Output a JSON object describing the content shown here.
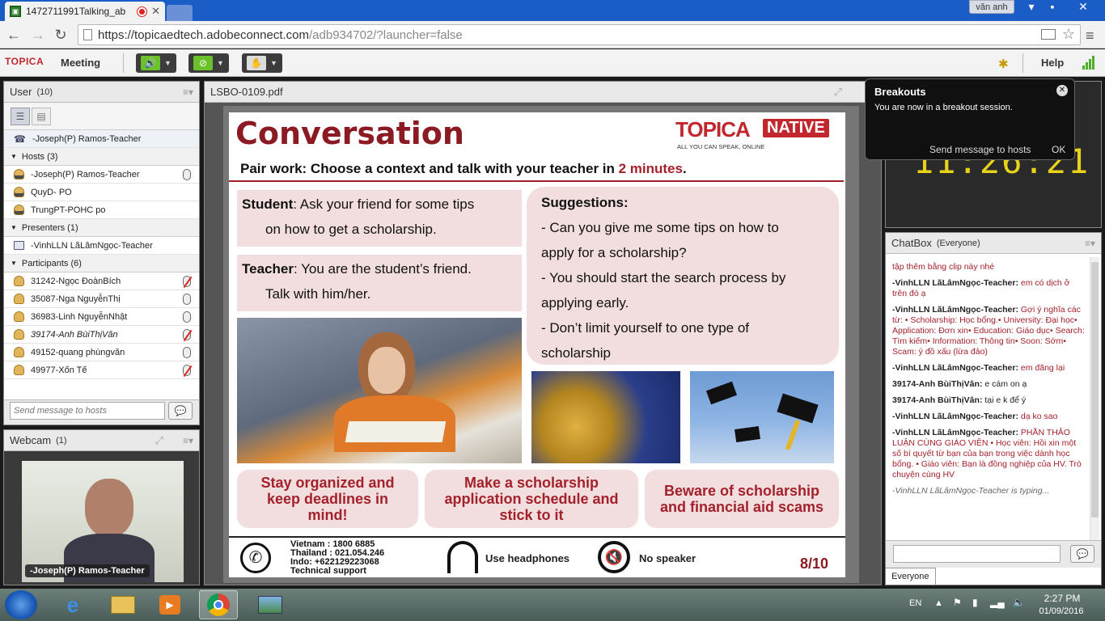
{
  "browser": {
    "tab_title": "1472711991Talking_ab",
    "user_name": "văn anh",
    "url_host": "https://topicaedtech.adobeconnect.com",
    "url_path": "/adb934702/?launcher=false"
  },
  "menubar": {
    "logo": "TOPICA",
    "meeting_label": "Meeting",
    "help_label": "Help"
  },
  "user_pod": {
    "title": "User",
    "count": "(10)",
    "current_user": "-Joseph(P) Ramos-Teacher",
    "hosts_label": "Hosts (3)",
    "hosts": [
      "-Joseph(P) Ramos-Teacher",
      "QuyD- PO",
      "TrungPT-POHC po"
    ],
    "presenters_label": "Presenters (1)",
    "presenters": [
      "-VinhLLN LãLâmNgọc-Teacher"
    ],
    "participants_label": "Participants (6)",
    "participants": [
      {
        "name": "31242-Ngọc ĐoànBích",
        "mic": "off",
        "italic": false
      },
      {
        "name": "35087-Nga NguyễnThị",
        "mic": "on",
        "italic": false
      },
      {
        "name": "36983-Linh NguyễnNhật",
        "mic": "on",
        "italic": false
      },
      {
        "name": "39174-Anh BùiThịVân",
        "mic": "off",
        "italic": true
      },
      {
        "name": "49152-quang phùngvăn",
        "mic": "on",
        "italic": false
      },
      {
        "name": "49977-Xốn Tế",
        "mic": "off",
        "italic": false
      }
    ],
    "send_placeholder": "Send message to hosts"
  },
  "webcam_pod": {
    "title": "Webcam",
    "count": "(1)",
    "caption": "-Joseph(P) Ramos-Teacher"
  },
  "share_pod": {
    "title": "LSBO-0109.pdf"
  },
  "slide": {
    "heading": "Conversation",
    "brand_main": "TOPICA",
    "brand_tag": "NATIVE",
    "brand_sub": "ALL YOU CAN SPEAK, ONLINE",
    "instruction_pre": "Pair work: Choose a context and talk with your teacher in ",
    "instruction_hl": "2 minutes",
    "instruction_post": ".",
    "student_label": "Student",
    "student_line1": ": Ask your friend for some tips",
    "student_line2": "on how to get a scholarship.",
    "teacher_label": "Teacher",
    "teacher_line1": ": You are the student’s friend.",
    "teacher_line2": "Talk with him/her.",
    "suggestions_title": "Suggestions:",
    "suggestions": [
      "- Can you give me some tips on how to",
      "apply for a scholarship?",
      "- You should start the search process by",
      "applying early.",
      "-  Don’t limit yourself to one type of",
      "scholarship"
    ],
    "tips": [
      "Stay organized and keep deadlines in mind!",
      "Make a scholarship application schedule and stick to it",
      "Beware of scholarship and financial aid scams"
    ],
    "support_lines": [
      "Vietnam :  1800 6885",
      "Thailand :  021.054.246",
      "Indo:   +622129223068",
      "Technical support"
    ],
    "headphones_label": "Use headphones",
    "speaker_label": "No speaker",
    "page": "8/10"
  },
  "breakouts": {
    "title": "Breakouts",
    "message": "You are now in a breakout session.",
    "send_label": "Send message to hosts",
    "ok_label": "OK",
    "timer": "11:26:21"
  },
  "chat_pod": {
    "title": "ChatBox",
    "scope": "(Everyone)",
    "messages": [
      {
        "who": "",
        "text": "tập thêm bằng clip này nhé",
        "red": true
      },
      {
        "who": "-VinhLLN LãLâmNgọc-Teacher:",
        "text": "em có dịch ở trên đó ạ",
        "red": true
      },
      {
        "who": "-VinhLLN LãLâmNgọc-Teacher:",
        "text": "Gợi ý nghĩa các từ:        •       Scholarship: Học bổng.•     University: Đại học•        Application: Đơn xin•       Education: Giáo dục•        Search: Tìm kiếm•         Information: Thông tin•       Soon: Sớm•        Scam: ý đồ xấu (lừa đảo)",
        "red": true
      },
      {
        "who": "-VinhLLN LãLâmNgọc-Teacher:",
        "text": "em đăng lại",
        "red": true
      },
      {
        "who": "39174-Anh BùiThịVân:",
        "text": "e cám on ạ",
        "red": false
      },
      {
        "who": "39174-Anh BùiThịVân:",
        "text": "tại e k để ý",
        "red": false
      },
      {
        "who": "-VinhLLN LãLâmNgọc-Teacher:",
        "text": "dạ ko sao",
        "red": true
      },
      {
        "who": "-VinhLLN LãLâmNgọc-Teacher:",
        "text": "PHẦN THẢO LUẬN CÙNG GIÁO VIÊN        •      Học viên: Hồi xin một số bí quyết từ bạn của bạn trong việc dành học bổng.          •  Giáo viên: Bạn là đồng nghiệp của HV. Trò chuyện cùng HV",
        "red": true
      }
    ],
    "typing": "-VinhLLN LãLâmNgọc-Teacher is typing...",
    "tab_label": "Everyone"
  },
  "taskbar": {
    "lang": "EN",
    "time": "2:27 PM",
    "date": "01/09/2016"
  },
  "colors": {
    "accent_red": "#a3212b",
    "titlebar_blue": "#1b5dc7",
    "topica_red": "#c1272d"
  }
}
